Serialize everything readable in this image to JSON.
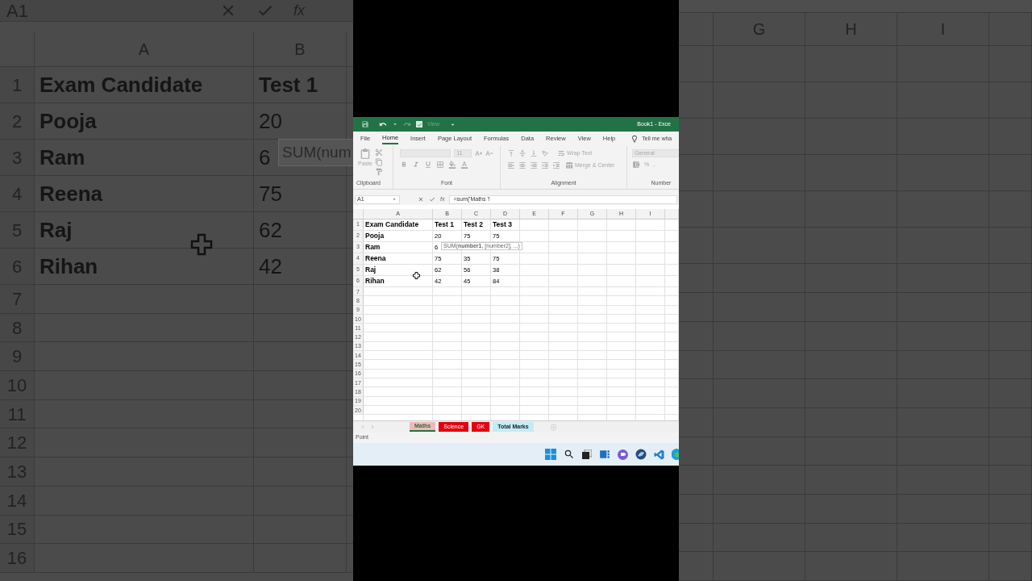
{
  "backdrop_left": {
    "name_box": "A1",
    "fx": "fx",
    "column_headers": [
      "A",
      "B"
    ],
    "row_numbers": [
      "1",
      "2",
      "3",
      "4",
      "5",
      "6",
      "7",
      "8",
      "9",
      "10",
      "11",
      "12",
      "13",
      "14",
      "15",
      "16"
    ],
    "rows": [
      [
        "Exam Candidate",
        "Test 1"
      ],
      [
        "Pooja",
        "20"
      ],
      [
        "Ram",
        "6"
      ],
      [
        "Reena",
        "75"
      ],
      [
        "Raj",
        "62"
      ],
      [
        "Rihan",
        "42"
      ]
    ],
    "tooltip": "SUM(num"
  },
  "backdrop_right": {
    "column_headers": [
      "G",
      "H",
      "I"
    ]
  },
  "window": {
    "title": "Book1 - Exce",
    "quick_access": {
      "view_label": "View",
      "view_checked": true
    },
    "menu": [
      {
        "label": "File",
        "selected": false
      },
      {
        "label": "Home",
        "selected": true
      },
      {
        "label": "Insert",
        "selected": false
      },
      {
        "label": "Page Layout",
        "selected": false
      },
      {
        "label": "Formulas",
        "selected": false
      },
      {
        "label": "Data",
        "selected": false
      },
      {
        "label": "Review",
        "selected": false
      },
      {
        "label": "View",
        "selected": false
      },
      {
        "label": "Help",
        "selected": false
      }
    ],
    "tell_me": "Tell me wha",
    "ribbon": {
      "disabled": true,
      "paste": "Paste",
      "font_size": "11",
      "wrap_text": "Wrap Text",
      "merge_center": "Merge & Center",
      "number_format": "General",
      "number_symbols": [
        "%",
        ","
      ],
      "groups": [
        "Clipboard",
        "Font",
        "Alignment",
        "Number"
      ]
    },
    "formula_bar": {
      "name_box": "A1",
      "fx": "fx",
      "formula": "=sum('Maths '!"
    },
    "columns": [
      "A",
      "B",
      "C",
      "D",
      "E",
      "F",
      "G",
      "H",
      "I"
    ],
    "rows": [
      {
        "number": "1",
        "cells": [
          "Exam Candidate",
          "Test 1",
          "Test 2",
          "Test 3"
        ]
      },
      {
        "number": "2",
        "cells": [
          "Pooja",
          "20",
          "75",
          "75"
        ]
      },
      {
        "number": "3",
        "cells": [
          "Ram",
          "6"
        ]
      },
      {
        "number": "4",
        "cells": [
          "Reena",
          "75",
          "35",
          "75"
        ]
      },
      {
        "number": "5",
        "cells": [
          "Raj",
          "62",
          "56",
          "38"
        ]
      },
      {
        "number": "6",
        "cells": [
          "Rihan",
          "42",
          "45",
          "84"
        ]
      }
    ],
    "empty_rows": [
      "7",
      "8",
      "9",
      "10",
      "11",
      "12",
      "13",
      "14",
      "15",
      "16",
      "17",
      "18",
      "19",
      "20"
    ],
    "tooltip": "SUM(**number1**, [number2], ...)",
    "sheet_tabs": [
      {
        "label": "Maths",
        "selected": true,
        "color": "#f2b8b8"
      },
      {
        "label": "Science",
        "selected": false,
        "color": "#e3000f"
      },
      {
        "label": "GK",
        "selected": false,
        "color": "#e3000f"
      },
      {
        "label": "Total Marks",
        "selected": false,
        "color": "#c3ecf5"
      }
    ],
    "status": "Point"
  }
}
